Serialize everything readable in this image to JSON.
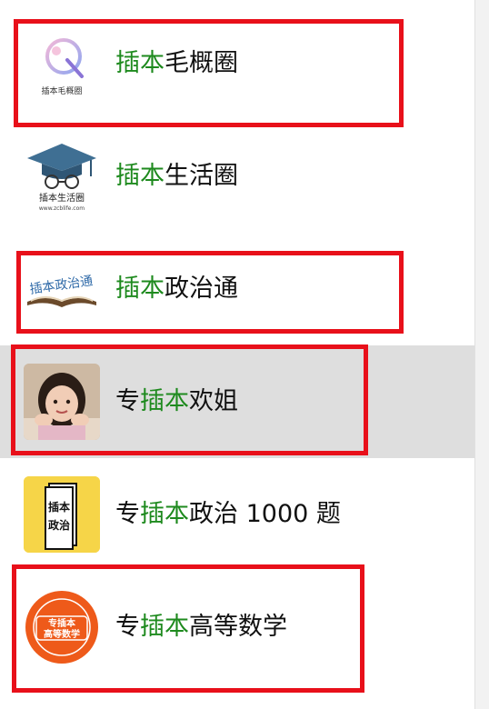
{
  "colors": {
    "keyword": "#1e8a1e",
    "text": "#111111",
    "highlight_box": "#e8101a",
    "selected_row": "#dedede"
  },
  "items": [
    {
      "prefix": "",
      "keyword": "插本",
      "rest": "毛概圈",
      "avatar_icon": "q-logo-icon",
      "avatar_text": "插本毛概圈"
    },
    {
      "prefix": "",
      "keyword": "插本",
      "rest": "生活圈",
      "avatar_icon": "graduation-cap-icon",
      "avatar_text": "插本生活圈",
      "avatar_subtext": "www.zcblife.com"
    },
    {
      "prefix": "",
      "keyword": "插本",
      "rest": "政治通",
      "avatar_icon": "open-book-icon",
      "avatar_text": "插本政治通"
    },
    {
      "prefix": "专",
      "keyword": "插本",
      "rest": "欢姐",
      "avatar_icon": "child-photo-icon"
    },
    {
      "prefix": "专",
      "keyword": "插本",
      "rest": "政治 1000 题",
      "avatar_icon": "book-cover-icon",
      "avatar_text_lines": [
        "插本",
        "政治"
      ]
    },
    {
      "prefix": "专",
      "keyword": "插本",
      "rest": "高等数学",
      "avatar_icon": "orange-seal-icon",
      "avatar_text_lines": [
        "专插本",
        "高等数学"
      ]
    }
  ]
}
